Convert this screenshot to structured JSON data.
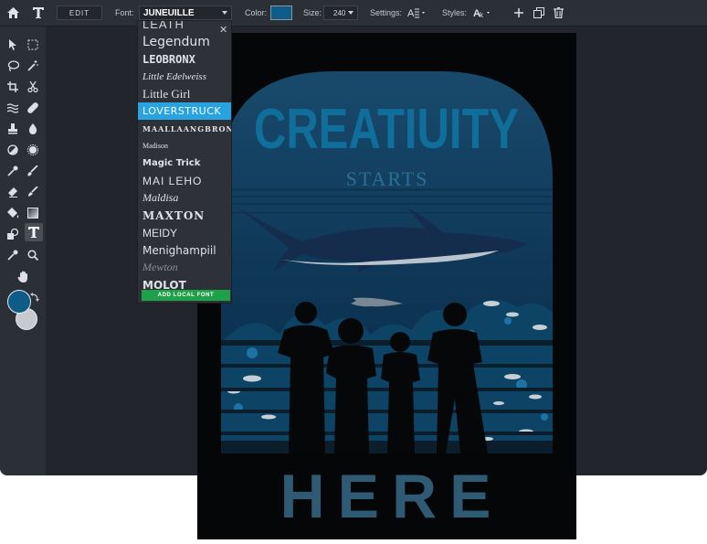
{
  "topbar": {
    "edit_label": "EDIT",
    "font_label": "Font:",
    "font_value": "JUNEUILLE",
    "color_label": "Color:",
    "color_value": "#0e5c88",
    "size_label": "Size:",
    "size_value": "240",
    "settings_label": "Settings:",
    "styles_label": "Styles:",
    "icons": [
      "home-icon",
      "text-logo-icon",
      "align-settings-icon",
      "char-styles-icon",
      "add-icon",
      "duplicate-icon",
      "trash-icon"
    ]
  },
  "font_dropdown": {
    "items": [
      "LEATH",
      "Legendum",
      "LEOBRONX",
      "Little Edelweiss",
      "Little Girl",
      "LOVERSTRUCK",
      "MAALLAANGBRONKS",
      "Madison",
      "Magic Trick",
      "MAI LEHO",
      "Maldisa",
      "MAXTON",
      "MEIDY",
      "Menighampiil",
      "Mewton",
      "MOLOT"
    ],
    "selected_index": 5,
    "add_local_label": "ADD LOCAL FONT"
  },
  "toolbar": {
    "tools": [
      "select-arrow-icon",
      "marquee-icon",
      "lasso-icon",
      "magic-wand-icon",
      "crop-icon",
      "scissors-icon",
      "liquify-icon",
      "heal-bandage-icon",
      "stamp-icon",
      "blur-drop-icon",
      "dodge-icon",
      "sponge-icon",
      "eyedropper-icon",
      "brush-icon",
      "eraser-icon",
      "smudge-brush-icon",
      "fill-bucket-icon",
      "gradient-icon",
      "shape-icon",
      "text-tool-icon",
      "color-picker-icon",
      "zoom-icon",
      "hand-icon"
    ],
    "active_tool": "text-tool-icon",
    "foreground_color": "#0e5c88",
    "background_color": "#c7cbd0"
  },
  "poster": {
    "title": "CREATIUITY",
    "subtitle": "STARTS",
    "bottom": "HERE",
    "colors": {
      "title": "#0f6e9a",
      "subtitle": "#2b6f93",
      "bottom": "#2f5a74",
      "sky_top": "#164565",
      "sky_bottom": "#0a2b44"
    }
  }
}
